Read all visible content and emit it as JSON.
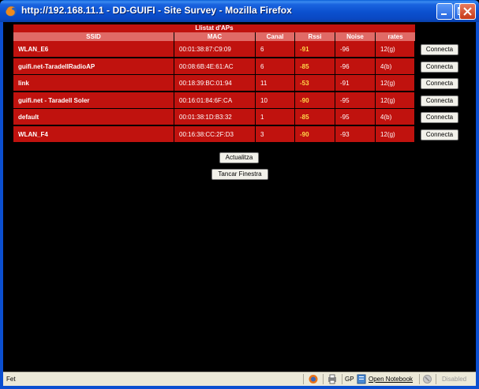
{
  "window": {
    "title": "http://192.168.11.1 - DD-GUIFI - Site Survey - Mozilla Firefox"
  },
  "survey": {
    "caption": "Llistat d'APs",
    "columns": [
      "SSID",
      "MAC",
      "Canal",
      "Rssi",
      "Noise",
      "rates"
    ],
    "rows": [
      {
        "ssid": "WLAN_E6",
        "mac": "00:01:38:87:C9:09",
        "canal": "6",
        "rssi": "-91",
        "noise": "-96",
        "rates": "12(g)",
        "button": "Connecta"
      },
      {
        "ssid": "guifi.net-TaradellRadioAP",
        "mac": "00:08:6B:4E:61:AC",
        "canal": "6",
        "rssi": "-85",
        "noise": "-96",
        "rates": "4(b)",
        "button": "Connecta"
      },
      {
        "ssid": "link",
        "mac": "00:18:39:BC:01:94",
        "canal": "11",
        "rssi": "-53",
        "noise": "-91",
        "rates": "12(g)",
        "button": "Connecta"
      },
      {
        "ssid": "guifi.net - Taradell Soler",
        "mac": "00:16:01:84:6F:CA",
        "canal": "10",
        "rssi": "-90",
        "noise": "-95",
        "rates": "12(g)",
        "button": "Connecta"
      },
      {
        "ssid": "default",
        "mac": "00:01:38:1D:B3:32",
        "canal": "1",
        "rssi": "-85",
        "noise": "-95",
        "rates": "4(b)",
        "button": "Connecta"
      },
      {
        "ssid": "WLAN_F4",
        "mac": "00:16:38:CC:2F:D3",
        "canal": "3",
        "rssi": "-90",
        "noise": "-93",
        "rates": "12(g)",
        "button": "Connecta"
      }
    ],
    "refresh_label": "Actualitza",
    "close_label": "Tancar Finestra"
  },
  "statusbar": {
    "status": "Fet",
    "gp_label": "GP",
    "notebook_label": "Open Notebook",
    "disabled_label": "Disabled"
  },
  "colors": {
    "row_bg": "#c0120e",
    "header_bg": "#e06a66",
    "rssi_text": "#ffd84a",
    "page_bg": "#000000"
  }
}
